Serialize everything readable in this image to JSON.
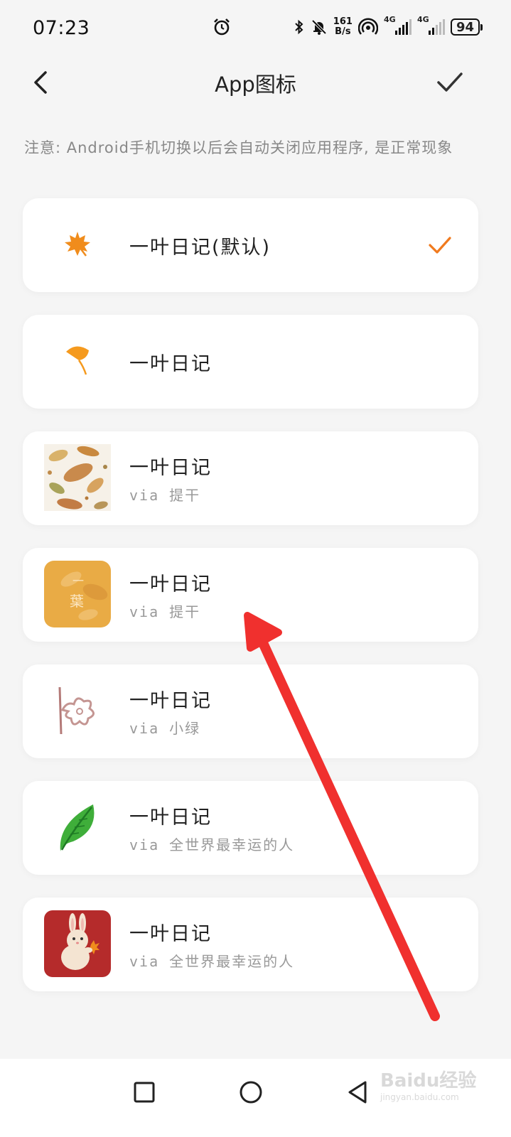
{
  "status_bar": {
    "time": "07:23",
    "net_speed_value": "161",
    "net_speed_unit": "B/s",
    "signal_label_1": "4G",
    "signal_label_2": "4G",
    "battery": "94"
  },
  "header": {
    "title": "App图标",
    "back_icon": "chevron-left-icon",
    "confirm_icon": "checkmark-icon"
  },
  "notice": "注意: Android手机切换以后会自动关闭应用程序, 是正常现象",
  "options": [
    {
      "name": "一叶日记(默认)",
      "via": "",
      "icon": "orange-maple-leaf-icon",
      "selected": true
    },
    {
      "name": "一叶日记",
      "via": "",
      "icon": "orange-ginkgo-leaf-icon",
      "selected": false
    },
    {
      "name": "一叶日记",
      "via": "via 提干",
      "icon": "autumn-leaves-pattern-icon",
      "selected": false
    },
    {
      "name": "一叶日记",
      "via": "via 提干",
      "icon": "yellow-leaf-calligraphy-icon",
      "selected": false
    },
    {
      "name": "一叶日记",
      "via": "via 小绿",
      "icon": "pink-sketch-flower-icon",
      "selected": false
    },
    {
      "name": "一叶日记",
      "via": "via 全世界最幸运的人",
      "icon": "green-leaf-icon",
      "selected": false
    },
    {
      "name": "一叶日记",
      "via": "via 全世界最幸运的人",
      "icon": "rabbit-holding-leaf-icon",
      "selected": false
    }
  ],
  "icon5_text_top": "一",
  "icon5_text_bottom": "葉",
  "accent_color": "#f07a1e",
  "watermark": {
    "brand": "Baidu经验",
    "url": "jingyan.baidu.com"
  }
}
